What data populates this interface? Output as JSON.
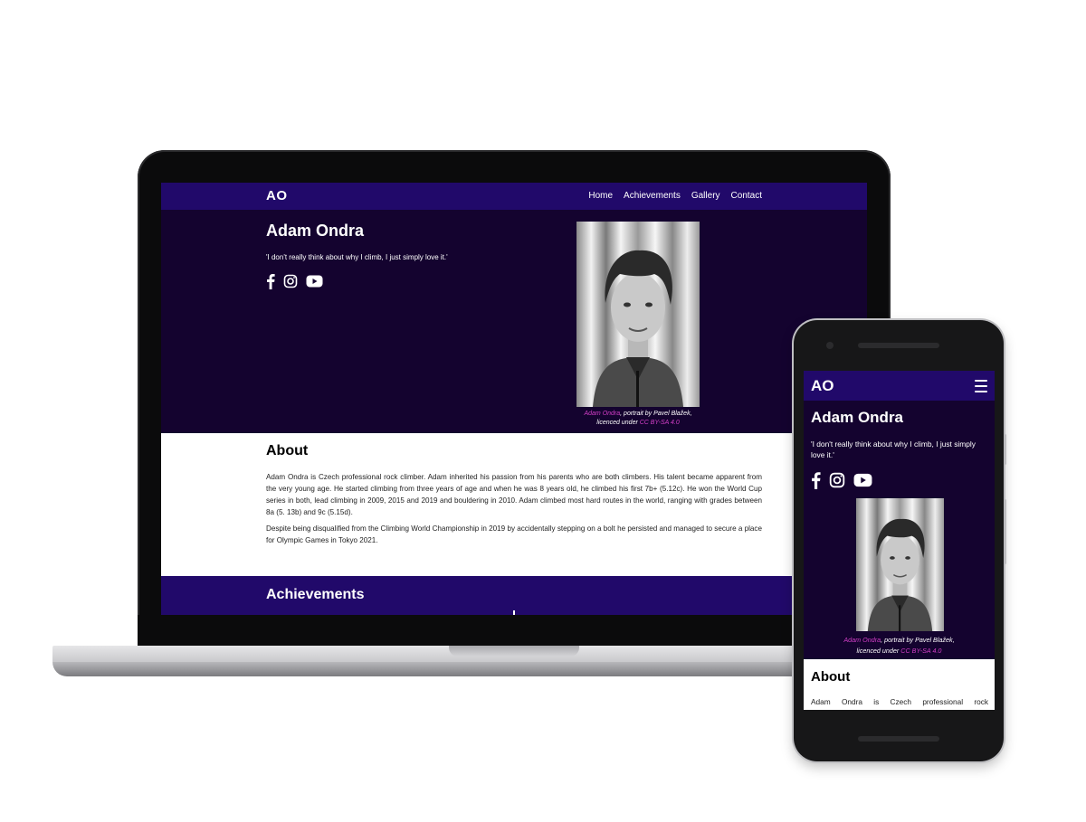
{
  "site": {
    "logo": "AO",
    "nav": [
      "Home",
      "Achievements",
      "Gallery",
      "Contact"
    ],
    "hero": {
      "title": "Adam Ondra",
      "quote": "'I don't really think about why I climb, I just simply love it.'",
      "social_icons": [
        "facebook-icon",
        "instagram-icon",
        "youtube-icon"
      ],
      "caption": {
        "link_name": "Adam Ondra",
        "text_1": ", portrait by Pavel Blažek,",
        "text_2": "licenced under ",
        "license": "CC BY-SA 4.0"
      }
    },
    "about": {
      "title": "About",
      "paragraph_1": "Adam Ondra is Czech professional rock climber. Adam inherited his passion from his parents who are both climbers. His talent became apparent from the very young age. He started climbing from three years of age and when he was 8 years old, he climbed his first 7b+ (5.12c). He won the World Cup series in both, lead climbing in 2009, 2015 and 2019 and bouldering in 2010. Adam climbed most hard routes in the world, ranging with grades between 8a (5. 13b) and 9c (5.15d).",
      "paragraph_2": "Despite being disqualified from the Climbing World Championship in 2019 by accidentally stepping on a bolt he persisted and managed to secure a place for Olympic Games in Tokyo 2021."
    },
    "achievements": {
      "title": "Achievements"
    }
  },
  "mobile": {
    "about_preview": "Adam Ondra is Czech professional rock"
  },
  "colors": {
    "nav": "#21096a",
    "hero": "#14032f",
    "accent": "#d33fc7"
  }
}
